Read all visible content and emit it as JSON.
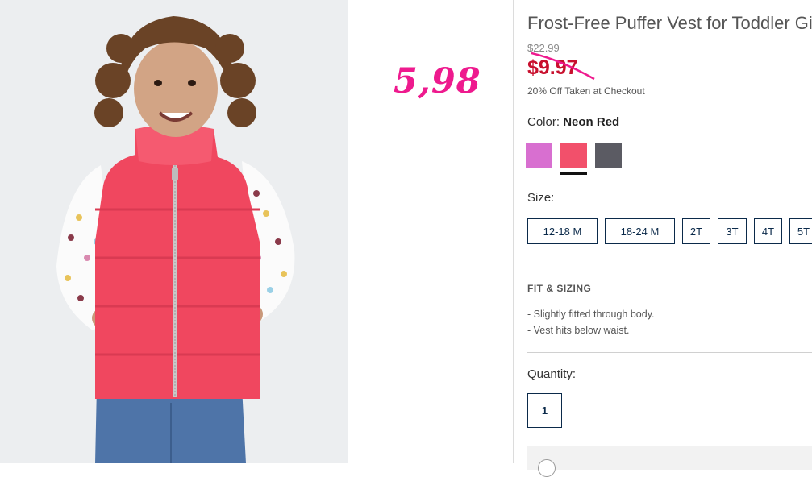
{
  "product": {
    "title": "Frost-Free Puffer Vest for Toddler Girls",
    "original_price": "$22.99",
    "sale_price": "$9.97",
    "promo_text": "20% Off Taken at Checkout",
    "image_alt": "Toddler girl wearing neon red puffer vest"
  },
  "annotation": {
    "text": "5,98",
    "color": "#ee1a8e"
  },
  "color": {
    "label": "Color:",
    "selected": "Neon Red",
    "swatches": [
      {
        "name": "Purple",
        "hex": "#d86fd0"
      },
      {
        "name": "Neon Red",
        "hex": "#f2506b"
      },
      {
        "name": "Gray",
        "hex": "#5b5b63"
      }
    ]
  },
  "size": {
    "label": "Size:",
    "options": [
      "12-18 M",
      "18-24 M",
      "2T",
      "3T",
      "4T",
      "5T"
    ]
  },
  "fit": {
    "title": "FIT & SIZING",
    "items": [
      "-  Slightly fitted through body.",
      "-  Vest hits below waist."
    ]
  },
  "quantity": {
    "label": "Quantity:",
    "value": "1"
  }
}
